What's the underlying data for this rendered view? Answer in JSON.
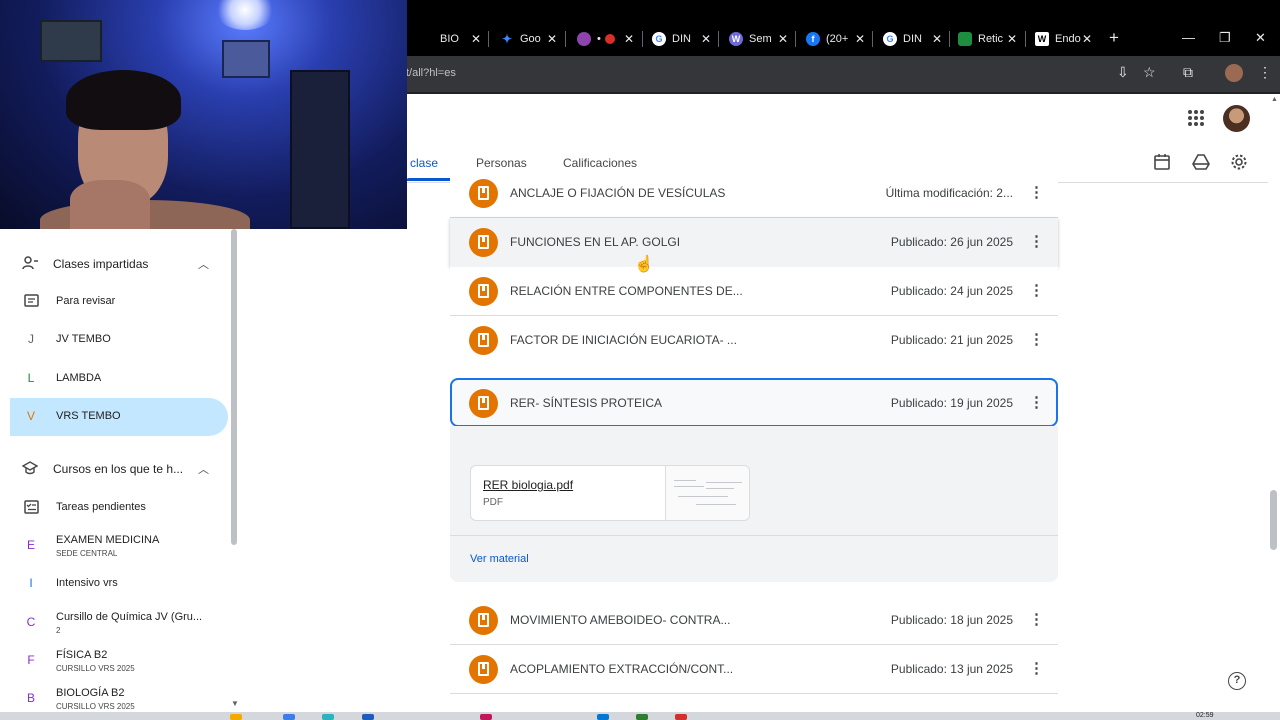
{
  "browser": {
    "tabs": [
      {
        "label": "BIO",
        "favicon_color": "#000000"
      },
      {
        "label": "Goo",
        "favicon_color": "#4285f4"
      },
      {
        "label": "•",
        "favicon_color": "#8e44ad"
      },
      {
        "label": "DIN",
        "favicon_color": "#ffffff"
      },
      {
        "label": "Sem",
        "favicon_color": "#6f6ad9"
      },
      {
        "label": "(20+",
        "favicon_color": "#1877f2"
      },
      {
        "label": "DIN",
        "favicon_color": "#ffffff"
      },
      {
        "label": "Retic",
        "favicon_color": "#1e8e3e"
      },
      {
        "label": "Endo",
        "favicon_color": "#ffffff"
      }
    ],
    "url": "t/all?hl=es"
  },
  "header": {
    "tabs": [
      {
        "label": "clase",
        "active": true
      },
      {
        "label": "Personas",
        "active": false
      },
      {
        "label": "Calificaciones",
        "active": false
      }
    ]
  },
  "sidebar": {
    "section_teaching": "Clases impartidas",
    "teaching_items": [
      {
        "label": "Para revisar",
        "icon": "review-icon"
      },
      {
        "label": "JV TEMBO",
        "letter": "J"
      },
      {
        "label": "LAMBDA",
        "letter": "L"
      },
      {
        "label": "VRS TEMBO",
        "letter": "V",
        "active": true
      }
    ],
    "section_enrolled": "Cursos en los que te h...",
    "enrolled_items": [
      {
        "label": "Tareas pendientes",
        "icon": "todo-icon"
      },
      {
        "label": "EXAMEN MEDICINA",
        "sub": "SEDE CENTRAL",
        "letter": "E"
      },
      {
        "label": "Intensivo vrs",
        "letter": "I"
      },
      {
        "label": "Cursillo de Química JV (Gru...",
        "sub": "2",
        "letter": "C"
      },
      {
        "label": "FÍSICA B2",
        "sub": "CURSILLO VRS 2025",
        "letter": "F"
      },
      {
        "label": "BIOLOGÍA B2",
        "sub": "CURSILLO VRS 2025",
        "letter": "B"
      }
    ]
  },
  "materials": [
    {
      "title": "ANCLAJE O FIJACIÓN DE VESÍCULAS",
      "date": "Última modificación: 2..."
    },
    {
      "title": "FUNCIONES EN EL AP. GOLGI",
      "date": "Publicado: 26 jun 2025"
    },
    {
      "title": "RELACIÓN ENTRE COMPONENTES DE...",
      "date": "Publicado: 24 jun 2025"
    },
    {
      "title": "FACTOR DE INICIACIÓN EUCARIOTA- ...",
      "date": "Publicado: 21 jun 2025"
    },
    {
      "title": "RER- SÍNTESIS PROTEICA",
      "date": "Publicado: 19 jun 2025"
    },
    {
      "title": "MOVIMIENTO AMEBOIDEO- CONTRA...",
      "date": "Publicado: 18 jun 2025"
    },
    {
      "title": "ACOPLAMIENTO EXTRACCIÓN/CONT...",
      "date": "Publicado: 13 jun 2025"
    }
  ],
  "expanded": {
    "attachment_name": "RER biologia.pdf",
    "attachment_type": "PDF",
    "link_label": "Ver material"
  },
  "taskbar": {
    "clock": "02:59"
  },
  "colors": {
    "accent": "#0b57d0",
    "material_icon": "#e37400",
    "selected_border": "#1a73e8",
    "active_class_bg": "#c2e7ff"
  }
}
